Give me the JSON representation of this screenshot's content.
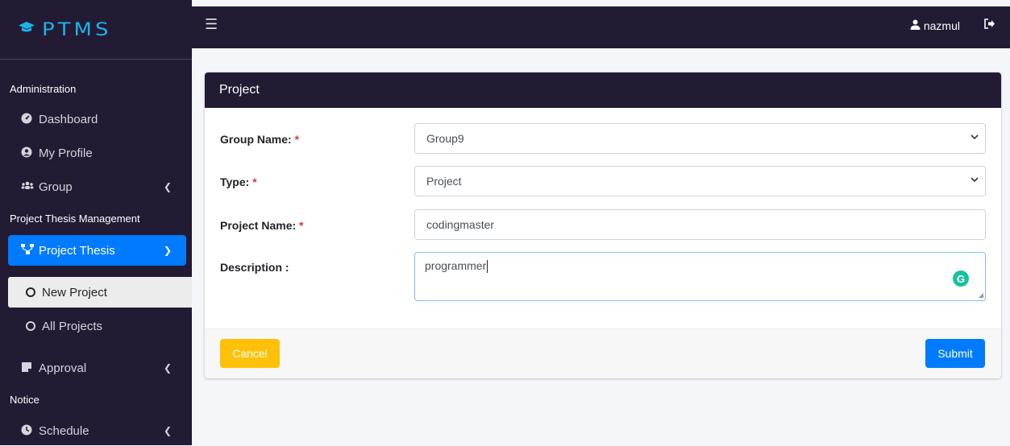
{
  "brand": {
    "logo_text": "PTMS"
  },
  "sidebar": {
    "sections": [
      "Administration",
      "Project Thesis Management",
      "Notice"
    ],
    "items": [
      {
        "label": "Dashboard",
        "icon": "tachometer-icon"
      },
      {
        "label": "My Profile",
        "icon": "user-circle-icon"
      },
      {
        "label": "Group",
        "icon": "users-icon"
      },
      {
        "label": "Project Thesis",
        "icon": "sitemap-icon"
      },
      {
        "label": "Approval",
        "icon": "note-icon"
      },
      {
        "label": "Schedule",
        "icon": "clock-icon"
      }
    ],
    "sub_items": [
      {
        "label": "New Project"
      },
      {
        "label": "All Projects"
      }
    ]
  },
  "topbar": {
    "username": "nazmul"
  },
  "card": {
    "title": "Project",
    "fields": {
      "group_label": "Group Name:",
      "group_value": "Group9",
      "type_label": "Type:",
      "type_value": "Project",
      "project_name_label": "Project Name:",
      "project_name_value": "codingmaster",
      "description_label": "Description :",
      "description_value": "programmer",
      "required_mark": "*"
    },
    "cancel_label": "Cancel",
    "submit_label": "Submit"
  },
  "colors": {
    "sidebar_bg": "#231a34",
    "accent": "#007bff",
    "cancel": "#ffc107",
    "required": "#dc3545",
    "grammarly": "#15c39a"
  }
}
